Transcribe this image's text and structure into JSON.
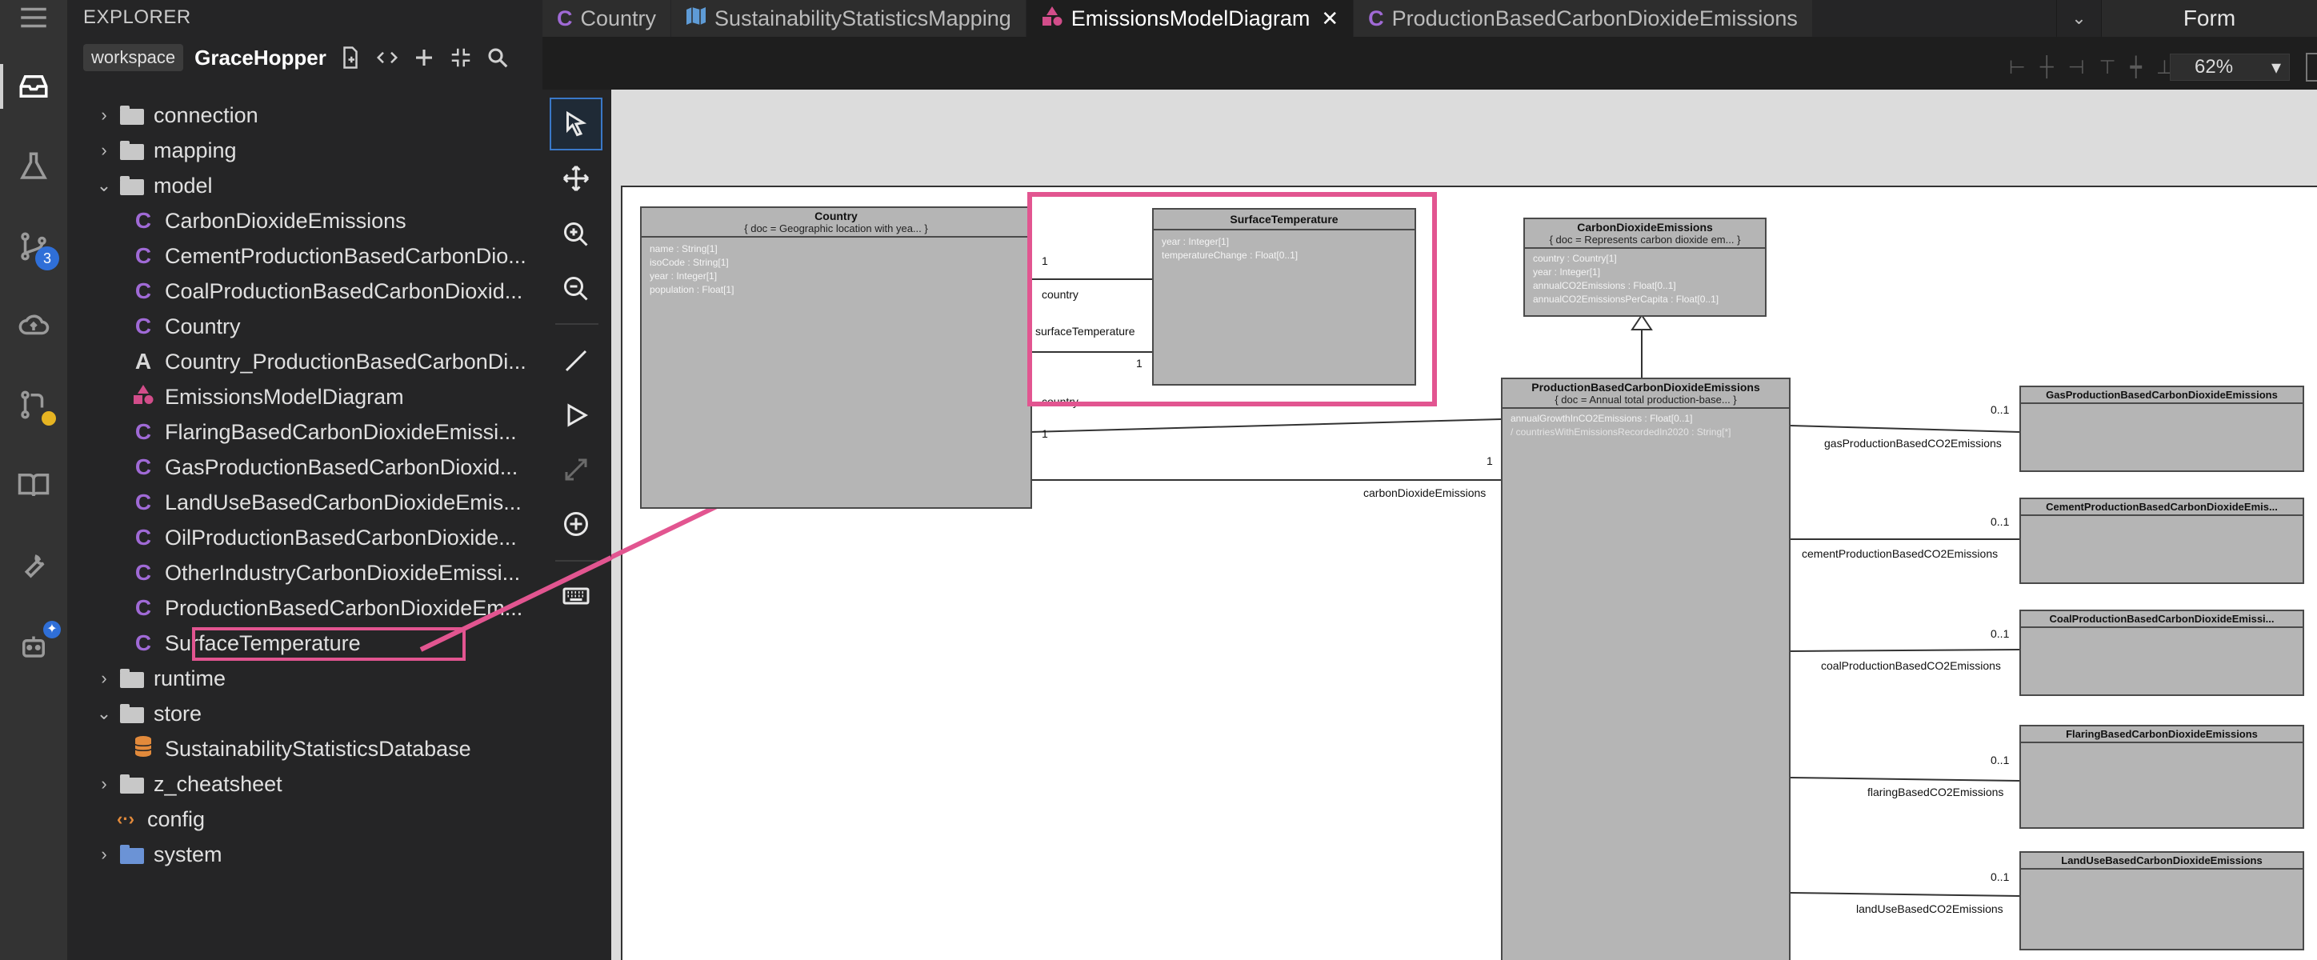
{
  "sidebar": {
    "title": "EXPLORER",
    "workspace_tag": "workspace",
    "workspace_name": "GraceHopper",
    "tree": [
      {
        "label": "connection",
        "kind": "folder",
        "expanded": false
      },
      {
        "label": "mapping",
        "kind": "folder",
        "expanded": false
      },
      {
        "label": "model",
        "kind": "folder",
        "expanded": true
      },
      {
        "label": "CarbonDioxideEmissions",
        "kind": "class"
      },
      {
        "label": "CementProductionBasedCarbonDio...",
        "kind": "class"
      },
      {
        "label": "CoalProductionBasedCarbonDioxid...",
        "kind": "class"
      },
      {
        "label": "Country",
        "kind": "class"
      },
      {
        "label": "Country_ProductionBasedCarbonDi...",
        "kind": "association"
      },
      {
        "label": "EmissionsModelDiagram",
        "kind": "diagram"
      },
      {
        "label": "FlaringBasedCarbonDioxideEmissi...",
        "kind": "class"
      },
      {
        "label": "GasProductionBasedCarbonDioxid...",
        "kind": "class"
      },
      {
        "label": "LandUseBasedCarbonDioxideEmis...",
        "kind": "class"
      },
      {
        "label": "OilProductionBasedCarbonDioxide...",
        "kind": "class"
      },
      {
        "label": "OtherIndustryCarbonDioxideEmissi...",
        "kind": "class"
      },
      {
        "label": "ProductionBasedCarbonDioxideEm...",
        "kind": "class"
      },
      {
        "label": "SurfaceTemperature",
        "kind": "class"
      },
      {
        "label": "runtime",
        "kind": "folder",
        "expanded": false
      },
      {
        "label": "store",
        "kind": "folder",
        "expanded": true
      },
      {
        "label": "SustainabilityStatisticsDatabase",
        "kind": "database"
      },
      {
        "label": "z_cheatsheet",
        "kind": "folder",
        "expanded": false
      },
      {
        "label": "config",
        "kind": "config"
      },
      {
        "label": "system",
        "kind": "folder-blue",
        "expanded": false
      }
    ]
  },
  "activity": {
    "source_control_badge": "3"
  },
  "tabs": [
    {
      "label": "Country",
      "icon": "C"
    },
    {
      "label": "SustainabilityStatisticsMapping",
      "icon": "map-icon"
    },
    {
      "label": "EmissionsModelDiagram",
      "icon": "diagram-icon",
      "active": true,
      "close": "✕"
    },
    {
      "label": "ProductionBasedCarbonDioxideEmissions",
      "icon": "C"
    }
  ],
  "form_label": "Form",
  "zoom": "62%",
  "diagram": {
    "country": {
      "name": "Country",
      "doc": "{ doc = Geographic location with yea... }",
      "props": [
        "name : String[1]",
        "isoCode : String[1]",
        "year : Integer[1]",
        "population : Float[1]"
      ]
    },
    "surface_temperature": {
      "name": "SurfaceTemperature",
      "props": [
        "year : Integer[1]",
        "temperatureChange : Float[0..1]"
      ]
    },
    "carbon_dioxide_emissions": {
      "name": "CarbonDioxideEmissions",
      "doc": "{ doc = Represents carbon dioxide em... }",
      "props": [
        "country : Country[1]",
        "year : Integer[1]",
        "annualCO2Emissions : Float[0..1]",
        "annualCO2EmissionsPerCapita : Float[0..1]"
      ]
    },
    "production_based": {
      "name": "ProductionBasedCarbonDioxideEmissions",
      "doc": "{ doc = Annual total production-base... }",
      "props": [
        "annualGrowthInCO2Emissions : Float[0..1]",
        "/ countriesWithEmissionsRecordedIn2020 : String[*]"
      ]
    },
    "subclasses": [
      {
        "name": "GasProductionBasedCarbonDioxideEmissions",
        "role": "gasProductionBasedCO2Emissions",
        "mult": "0..1"
      },
      {
        "name": "CementProductionBasedCarbonDioxideEmis...",
        "role": "cementProductionBasedCO2Emissions",
        "mult": "0..1"
      },
      {
        "name": "CoalProductionBasedCarbonDioxideEmissi...",
        "role": "coalProductionBasedCO2Emissions",
        "mult": "0..1"
      },
      {
        "name": "FlaringBasedCarbonDioxideEmissions",
        "role": "flaringBasedCO2Emissions",
        "mult": "0..1"
      },
      {
        "name": "LandUseBasedCarbonDioxideEmissions",
        "role": "landUseBasedCO2Emissions",
        "mult": "0..1"
      }
    ],
    "assoc_labels": {
      "one_a": "1",
      "country_a": "country",
      "surfaceTemperature": "surfaceTemperature",
      "one_b": "1",
      "country_b": "country",
      "one_c": "1",
      "one_d": "1",
      "carbonDioxideEmissions": "carbonDioxideEmissions"
    }
  }
}
